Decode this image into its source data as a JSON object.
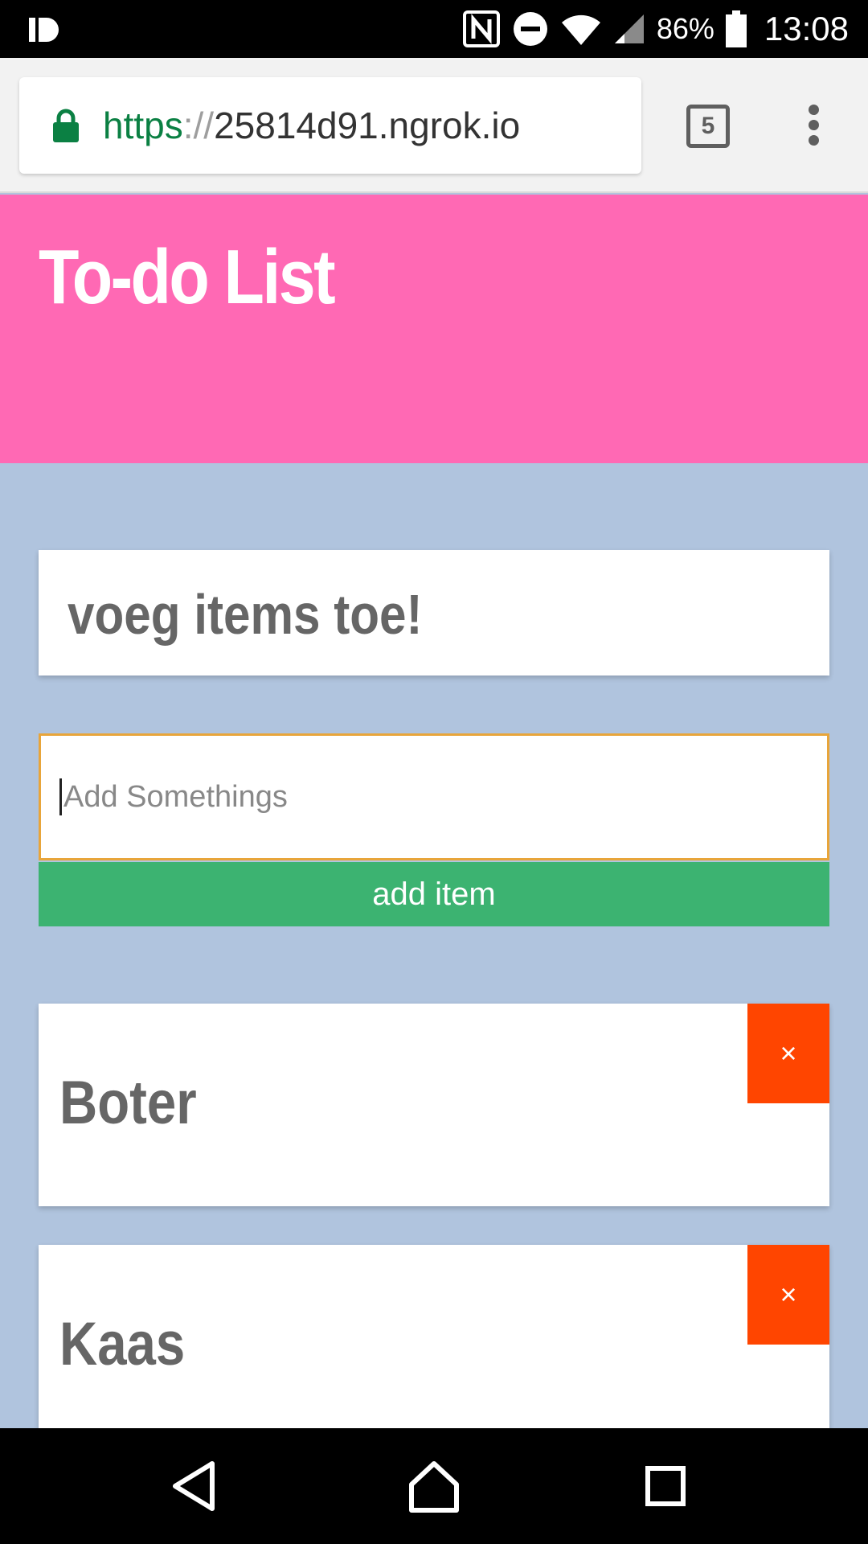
{
  "status_bar": {
    "battery_percent": "86%",
    "time": "13:08",
    "icons": [
      "app-notification-icon",
      "nfc-icon",
      "do-not-disturb-icon",
      "wifi-icon",
      "signal-icon",
      "battery-icon"
    ]
  },
  "browser": {
    "url_scheme": "https",
    "url_separator": "://",
    "url_host": "25814d91.ngrok.io",
    "tab_count": "5",
    "colors": {
      "scheme": "#0b8043",
      "chrome": "#f2f2f2"
    }
  },
  "page": {
    "title": "To-do List",
    "subtitle": "voeg items toe!",
    "input": {
      "placeholder": "Add Somethings",
      "value": ""
    },
    "add_button_label": "add item",
    "items": [
      {
        "label": "Boter",
        "delete_label": "×"
      },
      {
        "label": "Kaas",
        "delete_label": "×"
      }
    ],
    "colors": {
      "header": "#ff69b4",
      "background": "#b0c4de",
      "add_button": "#3cb371",
      "delete_button": "#ff4500",
      "input_focus_border": "#e8a53a"
    }
  },
  "nav_bar": {
    "buttons": [
      "back-icon",
      "home-icon",
      "recents-icon"
    ]
  }
}
